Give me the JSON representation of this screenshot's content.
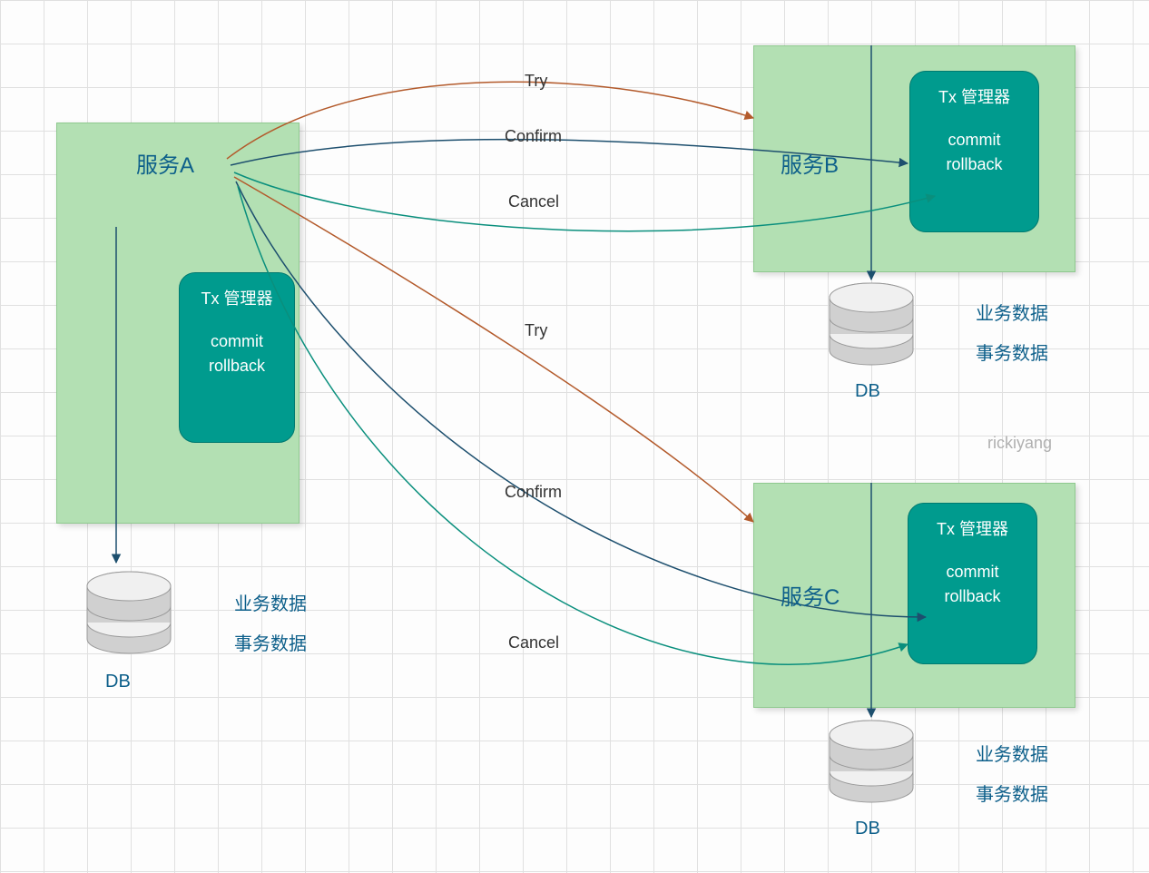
{
  "services": {
    "A": {
      "label": "服务A"
    },
    "B": {
      "label": "服务B"
    },
    "C": {
      "label": "服务C"
    }
  },
  "tx_manager": {
    "title": "Tx 管理器",
    "commit": "commit",
    "rollback": "rollback"
  },
  "db": {
    "label": "DB",
    "data_labels": {
      "business": "业务数据",
      "transaction": "事务数据"
    }
  },
  "edges": {
    "try": "Try",
    "confirm": "Confirm",
    "cancel": "Cancel"
  },
  "watermark": "rickiyang",
  "colors": {
    "service_bg": "#b3e0b3",
    "tx_bg": "#009b8e",
    "text_blue": "#0d5f8a",
    "try_edge": "#b35a2b",
    "confirm_edge": "#1d4f6e",
    "cancel_edge": "#0a8f7d"
  }
}
